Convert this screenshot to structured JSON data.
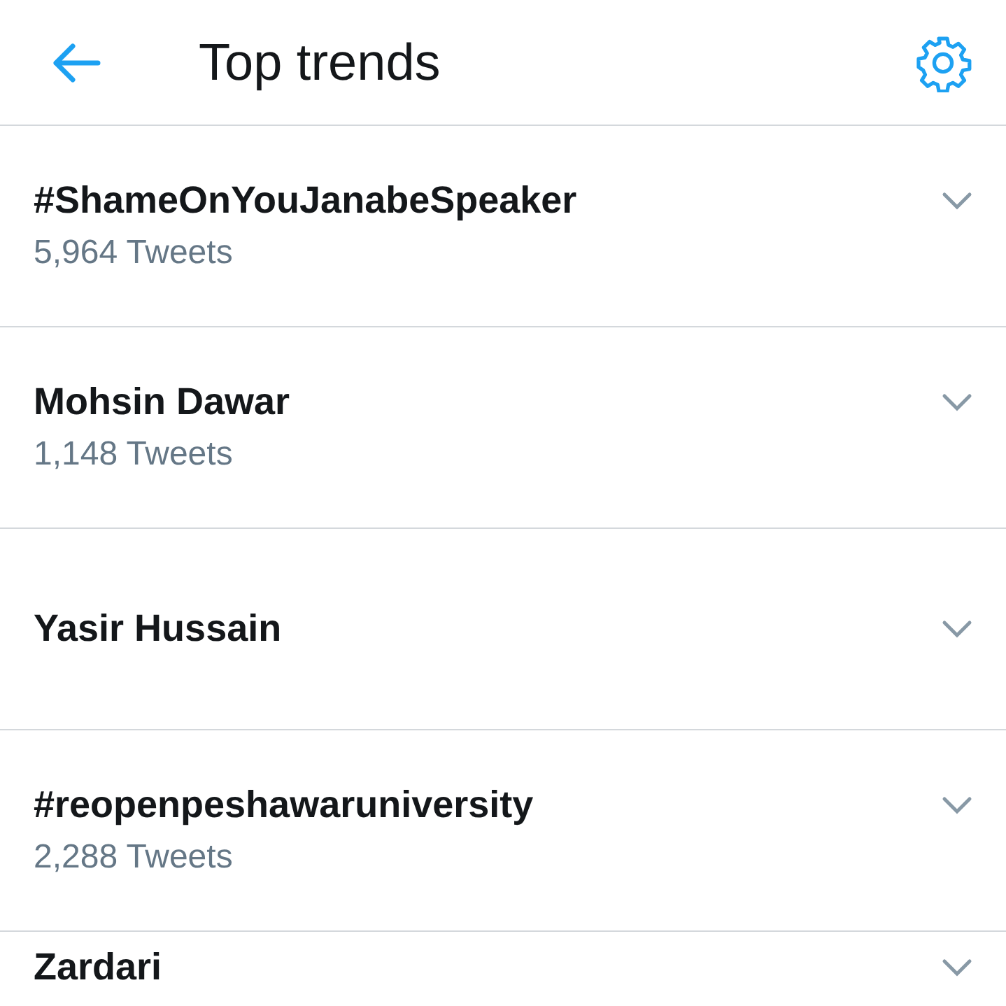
{
  "header": {
    "title": "Top trends"
  },
  "trends": [
    {
      "name": "#ShameOnYouJanabeSpeaker",
      "count": "5,964 Tweets"
    },
    {
      "name": "Mohsin Dawar",
      "count": "1,148 Tweets"
    },
    {
      "name": "Yasir Hussain"
    },
    {
      "name": "#reopenpeshawaruniversity",
      "count": "2,288 Tweets"
    },
    {
      "name": "Zardari"
    }
  ]
}
